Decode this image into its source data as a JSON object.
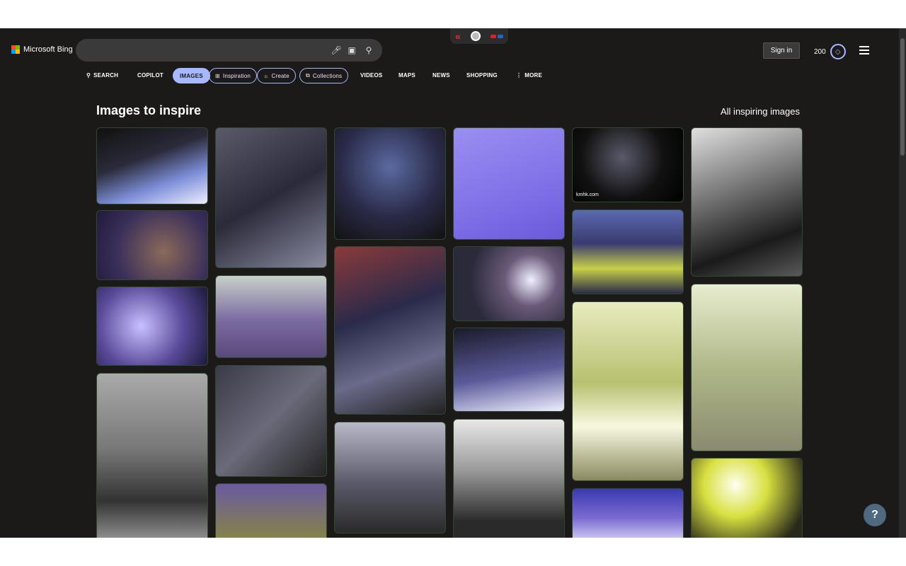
{
  "brand": {
    "name": "Microsoft Bing"
  },
  "search": {
    "placeholder": "",
    "icons": [
      "mic-icon",
      "visual-search-icon",
      "search-icon"
    ]
  },
  "extension": {
    "icons": [
      "back-arrows-icon",
      "record-icon",
      "3d-glasses-icon"
    ]
  },
  "header": {
    "sign_in": "Sign in",
    "points": "200"
  },
  "nav": {
    "tabs": [
      {
        "label": "SEARCH",
        "icon": "search-icon"
      },
      {
        "label": "COPILOT"
      },
      {
        "label": "IMAGES",
        "active": true
      },
      {
        "label": "Inspiration",
        "icon": "inspiration-icon"
      },
      {
        "label": "Create",
        "icon": "create-icon"
      },
      {
        "label": "Collections",
        "icon": "collections-icon"
      },
      {
        "label": "VIDEOS"
      },
      {
        "label": "MAPS"
      },
      {
        "label": "NEWS"
      },
      {
        "label": "SHOPPING"
      },
      {
        "label": "MORE",
        "icon": "more-dots-icon"
      }
    ]
  },
  "main": {
    "title": "Images to inspire",
    "all_link": "All inspiring images"
  },
  "tiles": [
    {
      "caption": ""
    },
    {
      "caption": ""
    },
    {
      "caption": ""
    },
    {
      "caption": ""
    },
    {
      "caption": ""
    },
    {
      "caption": ""
    },
    {
      "caption": ""
    },
    {
      "caption": ""
    },
    {
      "caption": ""
    },
    {
      "caption": ""
    },
    {
      "caption": ""
    },
    {
      "caption": ""
    },
    {
      "caption": ""
    },
    {
      "caption": ""
    },
    {
      "caption": ""
    },
    {
      "caption": ""
    },
    {
      "caption": "kmhk.com"
    },
    {
      "caption": ""
    },
    {
      "caption": ""
    },
    {
      "caption": ""
    },
    {
      "caption": ""
    },
    {
      "caption": ""
    },
    {
      "caption": ""
    },
    {
      "caption": ""
    }
  ],
  "colors": {
    "background": "#1b1a19",
    "accent": "#a8b8ff",
    "help": "#4f6a80"
  },
  "help": {
    "label": "?"
  }
}
